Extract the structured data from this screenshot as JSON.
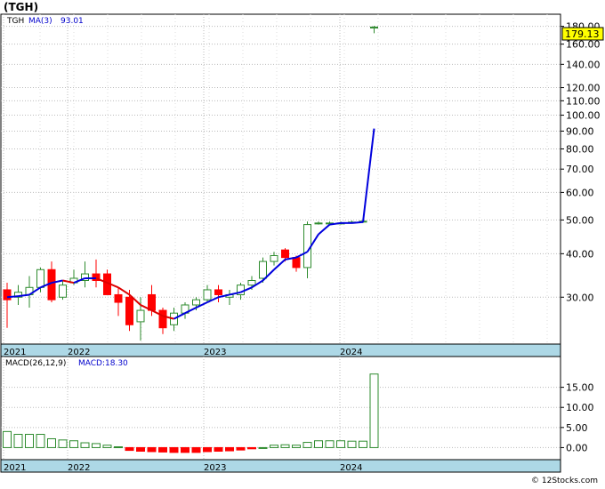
{
  "title": "(TGH)",
  "watermark": "© 12Stocks.com",
  "colors": {
    "up_candle": "#2e8b2e",
    "down_candle": "#ff0000",
    "ma_rising": "#0000dd",
    "ma_falling": "#dd0000",
    "axis_band": "#add8e6",
    "grid": "#bbbbbb",
    "price_box": "#ffff00",
    "macd_bar": "#2e8b2e",
    "macd_bar_neg": "#ff0000"
  },
  "chart_data": [
    {
      "type": "candlestick",
      "name": "price",
      "legend": {
        "ticker": "TGH",
        "ma_label": "MA(3)",
        "ma_value": "93.01"
      },
      "current_price": "179.13",
      "y_scale": "log",
      "ylim": [
        22,
        195
      ],
      "y_ticks": [
        30,
        40,
        50,
        60,
        70,
        80,
        90,
        100,
        110,
        120,
        140,
        160,
        180
      ],
      "y_tick_labels": [
        "30.00",
        "40.00",
        "50.00",
        "60.00",
        "70.00",
        "80.00",
        "90.00",
        "100.00",
        "110.00",
        "120.00",
        "140.00",
        "160.00",
        "180.00"
      ],
      "x_labels": [
        "2021",
        "2022",
        "2023",
        "2024"
      ],
      "grid": true,
      "candles": [
        {
          "o": 31.5,
          "h": 33.0,
          "l": 24.5,
          "c": 29.5
        },
        {
          "o": 30.0,
          "h": 32.5,
          "l": 28.5,
          "c": 31.0
        },
        {
          "o": 30.5,
          "h": 34.5,
          "l": 28.0,
          "c": 32.0
        },
        {
          "o": 32.0,
          "h": 36.5,
          "l": 31.0,
          "c": 36.0
        },
        {
          "o": 36.0,
          "h": 38.0,
          "l": 29.0,
          "c": 29.5
        },
        {
          "o": 30.0,
          "h": 33.5,
          "l": 29.5,
          "c": 32.5
        },
        {
          "o": 33.0,
          "h": 36.0,
          "l": 32.5,
          "c": 34.0
        },
        {
          "o": 33.5,
          "h": 38.0,
          "l": 32.0,
          "c": 35.0
        },
        {
          "o": 35.0,
          "h": 38.5,
          "l": 32.0,
          "c": 33.5
        },
        {
          "o": 35.0,
          "h": 36.0,
          "l": 31.5,
          "c": 30.5
        },
        {
          "o": 30.5,
          "h": 32.0,
          "l": 26.5,
          "c": 29.0
        },
        {
          "o": 30.0,
          "h": 31.5,
          "l": 24.0,
          "c": 25.0
        },
        {
          "o": 25.5,
          "h": 30.0,
          "l": 22.5,
          "c": 27.5
        },
        {
          "o": 30.5,
          "h": 32.5,
          "l": 26.5,
          "c": 27.5
        },
        {
          "o": 27.5,
          "h": 28.0,
          "l": 23.5,
          "c": 24.5
        },
        {
          "o": 25.0,
          "h": 28.0,
          "l": 24.0,
          "c": 27.0
        },
        {
          "o": 27.0,
          "h": 29.0,
          "l": 26.0,
          "c": 28.5
        },
        {
          "o": 28.5,
          "h": 30.0,
          "l": 27.5,
          "c": 29.5
        },
        {
          "o": 29.5,
          "h": 32.5,
          "l": 29.0,
          "c": 31.5
        },
        {
          "o": 31.5,
          "h": 32.5,
          "l": 29.0,
          "c": 30.5
        },
        {
          "o": 30.0,
          "h": 31.5,
          "l": 28.5,
          "c": 30.5
        },
        {
          "o": 30.5,
          "h": 33.0,
          "l": 29.5,
          "c": 32.5
        },
        {
          "o": 32.5,
          "h": 34.5,
          "l": 31.5,
          "c": 33.5
        },
        {
          "o": 34.0,
          "h": 39.0,
          "l": 33.0,
          "c": 38.0
        },
        {
          "o": 38.0,
          "h": 40.5,
          "l": 37.0,
          "c": 39.5
        },
        {
          "o": 41.0,
          "h": 41.5,
          "l": 38.0,
          "c": 39.0
        },
        {
          "o": 39.0,
          "h": 39.5,
          "l": 35.5,
          "c": 36.5
        },
        {
          "o": 36.5,
          "h": 49.5,
          "l": 34.0,
          "c": 48.5
        },
        {
          "o": 49.0,
          "h": 49.5,
          "l": 48.5,
          "c": 49.0
        },
        {
          "o": 49.0,
          "h": 49.5,
          "l": 48.5,
          "c": 49.0
        },
        {
          "o": 49.0,
          "h": 49.5,
          "l": 48.5,
          "c": 49.0
        },
        {
          "o": 49.2,
          "h": 49.8,
          "l": 48.8,
          "c": 49.3
        },
        {
          "o": 49.3,
          "h": 50.0,
          "l": 49.0,
          "c": 49.6
        },
        {
          "o": 178.0,
          "h": 180.5,
          "l": 172.0,
          "c": 179.13
        }
      ],
      "ma": [
        30.0,
        30.2,
        30.5,
        32.0,
        33.0,
        33.5,
        33.0,
        34.0,
        34.0,
        33.0,
        32.0,
        30.5,
        28.5,
        27.5,
        26.5,
        26.0,
        27.0,
        28.0,
        29.0,
        30.0,
        30.5,
        31.0,
        32.0,
        33.5,
        36.0,
        38.5,
        39.0,
        40.5,
        45.5,
        48.5,
        49.0,
        49.0,
        49.3,
        91.5
      ],
      "ma_falling": [
        false,
        false,
        false,
        false,
        false,
        false,
        true,
        false,
        false,
        true,
        true,
        true,
        true,
        true,
        true,
        true,
        false,
        false,
        false,
        false,
        false,
        false,
        false,
        false,
        false,
        false,
        false,
        false,
        false,
        false,
        false,
        false,
        false,
        false
      ]
    },
    {
      "type": "bar",
      "name": "macd",
      "legend": {
        "label": "MACD(26,12,9)",
        "value_label": "MACD:18.30"
      },
      "ylim": [
        -3,
        20
      ],
      "y_ticks": [
        0,
        5,
        10,
        15
      ],
      "y_tick_labels": [
        "0.00",
        "5.00",
        "10.00",
        "15.00"
      ],
      "x_labels": [
        "2021",
        "2022",
        "2023",
        "2024"
      ],
      "values": [
        4.0,
        3.3,
        3.3,
        3.3,
        2.2,
        1.9,
        1.7,
        1.2,
        1.0,
        0.6,
        0.2,
        -0.7,
        -0.9,
        -1.0,
        -1.1,
        -1.2,
        -1.2,
        -1.2,
        -1.0,
        -0.9,
        -0.8,
        -0.6,
        -0.3,
        0.0,
        0.6,
        0.7,
        0.6,
        1.3,
        1.7,
        1.7,
        1.7,
        1.6,
        1.6,
        18.3
      ]
    }
  ]
}
